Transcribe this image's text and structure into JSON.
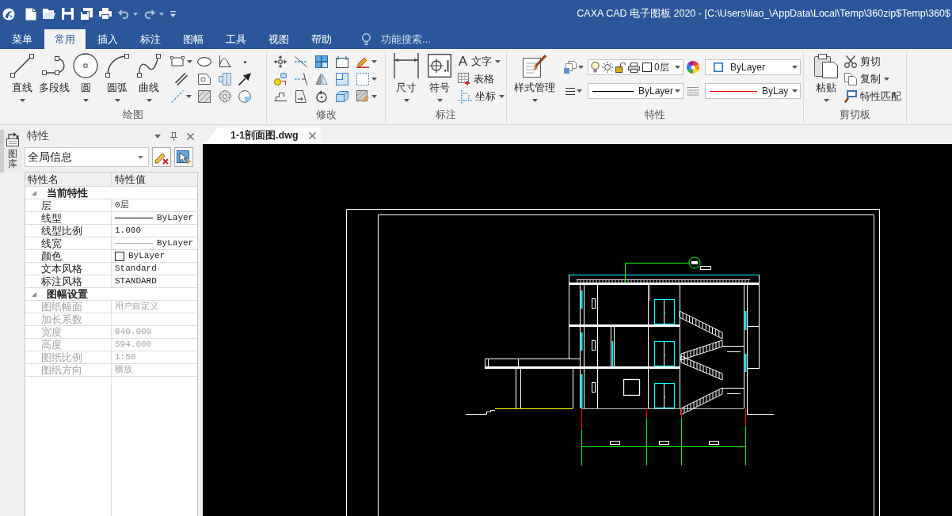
{
  "window": {
    "title": "CAXA CAD 电子图板 2020 - [C:\\Users\\liao_\\AppData\\Local\\Temp\\360zip$Temp\\360$"
  },
  "ribbon_tabs": [
    {
      "label": "菜单",
      "selected": false
    },
    {
      "label": "常用",
      "selected": true
    },
    {
      "label": "插入",
      "selected": false
    },
    {
      "label": "标注",
      "selected": false
    },
    {
      "label": "图幅",
      "selected": false
    },
    {
      "label": "工具",
      "selected": false
    },
    {
      "label": "视图",
      "selected": false
    },
    {
      "label": "帮助",
      "selected": false
    }
  ],
  "search": {
    "placeholder": "功能搜索..."
  },
  "ribbon_groups": [
    {
      "kind": "draw",
      "label": "绘图",
      "large_buttons": [
        {
          "label": "直线",
          "dropdown": true
        },
        {
          "label": "多段线",
          "dropdown": false
        },
        {
          "label": "圆",
          "dropdown": true
        },
        {
          "label": "圆弧",
          "dropdown": true
        },
        {
          "label": "曲线",
          "dropdown": true
        }
      ],
      "tool_buttons": [
        {
          "dropdown": true
        },
        {
          "dropdown": false
        },
        {
          "dropdown": false
        },
        {
          "dropdown": false
        },
        {
          "dropdown": false
        },
        {
          "dropdown": false
        },
        {
          "dropdown": false
        },
        {
          "dropdown": false
        },
        {
          "dropdown": true
        },
        {
          "dropdown": false
        },
        {
          "dropdown": false
        },
        {
          "dropdown": false
        }
      ]
    },
    {
      "kind": "modify",
      "label": "修改",
      "tool_buttons": [
        {
          "dropdown": false
        },
        {
          "dropdown": false
        },
        {
          "dropdown": false
        },
        {
          "dropdown": false
        },
        {
          "dropdown": true
        },
        {
          "dropdown": false
        },
        {
          "dropdown": false
        },
        {
          "dropdown": false
        },
        {
          "dropdown": false
        },
        {
          "dropdown": true
        },
        {
          "dropdown": false
        },
        {
          "dropdown": false
        },
        {
          "dropdown": false
        },
        {
          "dropdown": false
        },
        {
          "dropdown": true
        }
      ]
    },
    {
      "kind": "annotate",
      "label": "标注",
      "large_buttons": [
        {
          "label": "尺寸",
          "dropdown": true
        },
        {
          "label": "符号",
          "dropdown": true
        }
      ],
      "small_buttons": [
        {
          "label": "文字",
          "icon_text": "A",
          "dropdown": true
        },
        {
          "label": "表格",
          "dropdown": false
        },
        {
          "label": "坐标",
          "dropdown": true
        }
      ]
    },
    {
      "kind": "properties",
      "label": "特性",
      "large_buttons": [
        {
          "label": "样式管理",
          "dropdown": true
        }
      ],
      "combos": [
        {
          "kind": "layer",
          "value": "0层"
        },
        {
          "kind": "color",
          "value": "ByLayer"
        },
        {
          "kind": "linetype",
          "value": "ByLayer",
          "color": "#000000"
        },
        {
          "kind": "lineweight",
          "value": "ByLay",
          "color": "#ff0000"
        }
      ]
    },
    {
      "kind": "clipboard",
      "label": "剪切板",
      "large_buttons": [
        {
          "label": "粘贴",
          "dropdown": true
        }
      ],
      "small_buttons": [
        {
          "label": "剪切",
          "dropdown": false
        },
        {
          "label": "复制",
          "dropdown": true
        },
        {
          "label": "特性匹配",
          "dropdown": false
        }
      ]
    }
  ],
  "sidebar": {
    "tabs": [
      {
        "label": "图库"
      }
    ]
  },
  "properties_panel": {
    "title": "特性",
    "scope": "全局信息",
    "columns": [
      "特性名",
      "特性值"
    ],
    "sections": [
      {
        "label": "当前特性",
        "expanded": true,
        "rows": [
          {
            "name": "层",
            "value": "0层",
            "kind": "text",
            "disabled": false
          },
          {
            "name": "线型",
            "value": "ByLayer",
            "kind": "line",
            "disabled": false
          },
          {
            "name": "线型比例",
            "value": "1.000",
            "kind": "text",
            "disabled": false
          },
          {
            "name": "线宽",
            "value": "ByLayer",
            "kind": "thin-line",
            "disabled": false
          },
          {
            "name": "颜色",
            "value": "ByLayer",
            "kind": "swatch",
            "disabled": false
          },
          {
            "name": "文本风格",
            "value": "Standard",
            "kind": "text",
            "disabled": false
          },
          {
            "name": "标注风格",
            "value": "STANDARD",
            "kind": "text",
            "disabled": false
          }
        ]
      },
      {
        "label": "图幅设置",
        "expanded": true,
        "rows": [
          {
            "name": "图纸幅面",
            "value": "用户自定义",
            "kind": "text",
            "disabled": true
          },
          {
            "name": "加长系数",
            "kind": "text",
            "disabled": true
          },
          {
            "name": "宽度",
            "value": "840.000",
            "kind": "text",
            "disabled": true
          },
          {
            "name": "高度",
            "value": "594.000",
            "kind": "text",
            "disabled": true
          },
          {
            "name": "图纸比例",
            "value": "1:50",
            "kind": "text",
            "disabled": true
          },
          {
            "name": "图纸方向",
            "value": "横放",
            "kind": "text",
            "disabled": true
          }
        ]
      }
    ]
  },
  "document_tabs": [
    {
      "label": "1-1剖面图.dwg",
      "selected": true
    }
  ]
}
